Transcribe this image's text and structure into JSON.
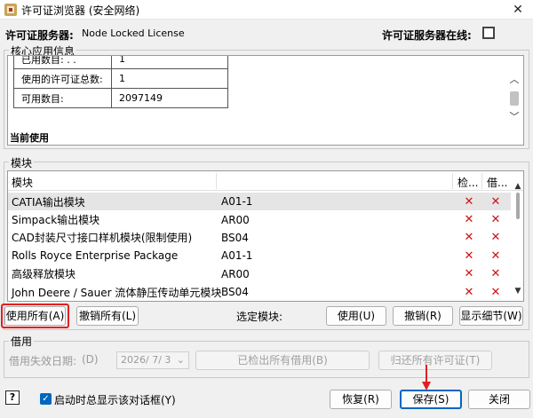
{
  "window": {
    "title": "许可证浏览器 (安全网络)",
    "close_glyph": "✕"
  },
  "server": {
    "label": "许可证服务器:",
    "value": "Node Locked License",
    "online_label": "许可证服务器在线:"
  },
  "core_info": {
    "group_title": "核心应用信息",
    "rows": [
      {
        "label": "已用数目: . .",
        "value": "1"
      },
      {
        "label": "使用的许可证总数:",
        "value": "1"
      },
      {
        "label": "可用数目:",
        "value": "2097149"
      }
    ],
    "current_use_label": "当前使用"
  },
  "modules": {
    "group_title": "模块",
    "columns": {
      "name": "模块",
      "check": "检...",
      "borrow": "借..."
    },
    "rows": [
      {
        "name": "CATIA输出模块",
        "code": "A01-1"
      },
      {
        "name": "Simpack输出模块",
        "code": "AR00"
      },
      {
        "name": "CAD封装尺寸接口样机模块(限制使用)",
        "code": "BS04"
      },
      {
        "name": "Rolls Royce Enterprise Package",
        "code": "A01-1"
      },
      {
        "name": "高级释放模块",
        "code": "AR00"
      },
      {
        "name": "John Deere / Sauer 流体静压传动单元模块",
        "code": "BS04"
      }
    ],
    "x_glyph": "✕"
  },
  "module_actions": {
    "use_all": "使用所有(A)",
    "revoke_all": "撤销所有(L)",
    "selected_label": "选定模块:",
    "use": "使用(U)",
    "revoke": "撤销(R)",
    "show_details": "显示细节(W)"
  },
  "borrow": {
    "group_title": "借用",
    "expiry_label": "借用失效日期:",
    "expiry_hint": "(D)",
    "date_value": "2026/ 7/ 3",
    "checked_out_all": "已检出所有借用(B)",
    "return_all": "归还所有许可证(T)"
  },
  "footer": {
    "help_glyph": "?",
    "startup_checkbox": "启动时总显示该对话框(Y)",
    "restore": "恢复(R)",
    "save": "保存(S)",
    "close": "关闭"
  },
  "colors": {
    "accent": "#0067c0",
    "highlight_red": "#e02020",
    "x_red": "#d01010"
  }
}
